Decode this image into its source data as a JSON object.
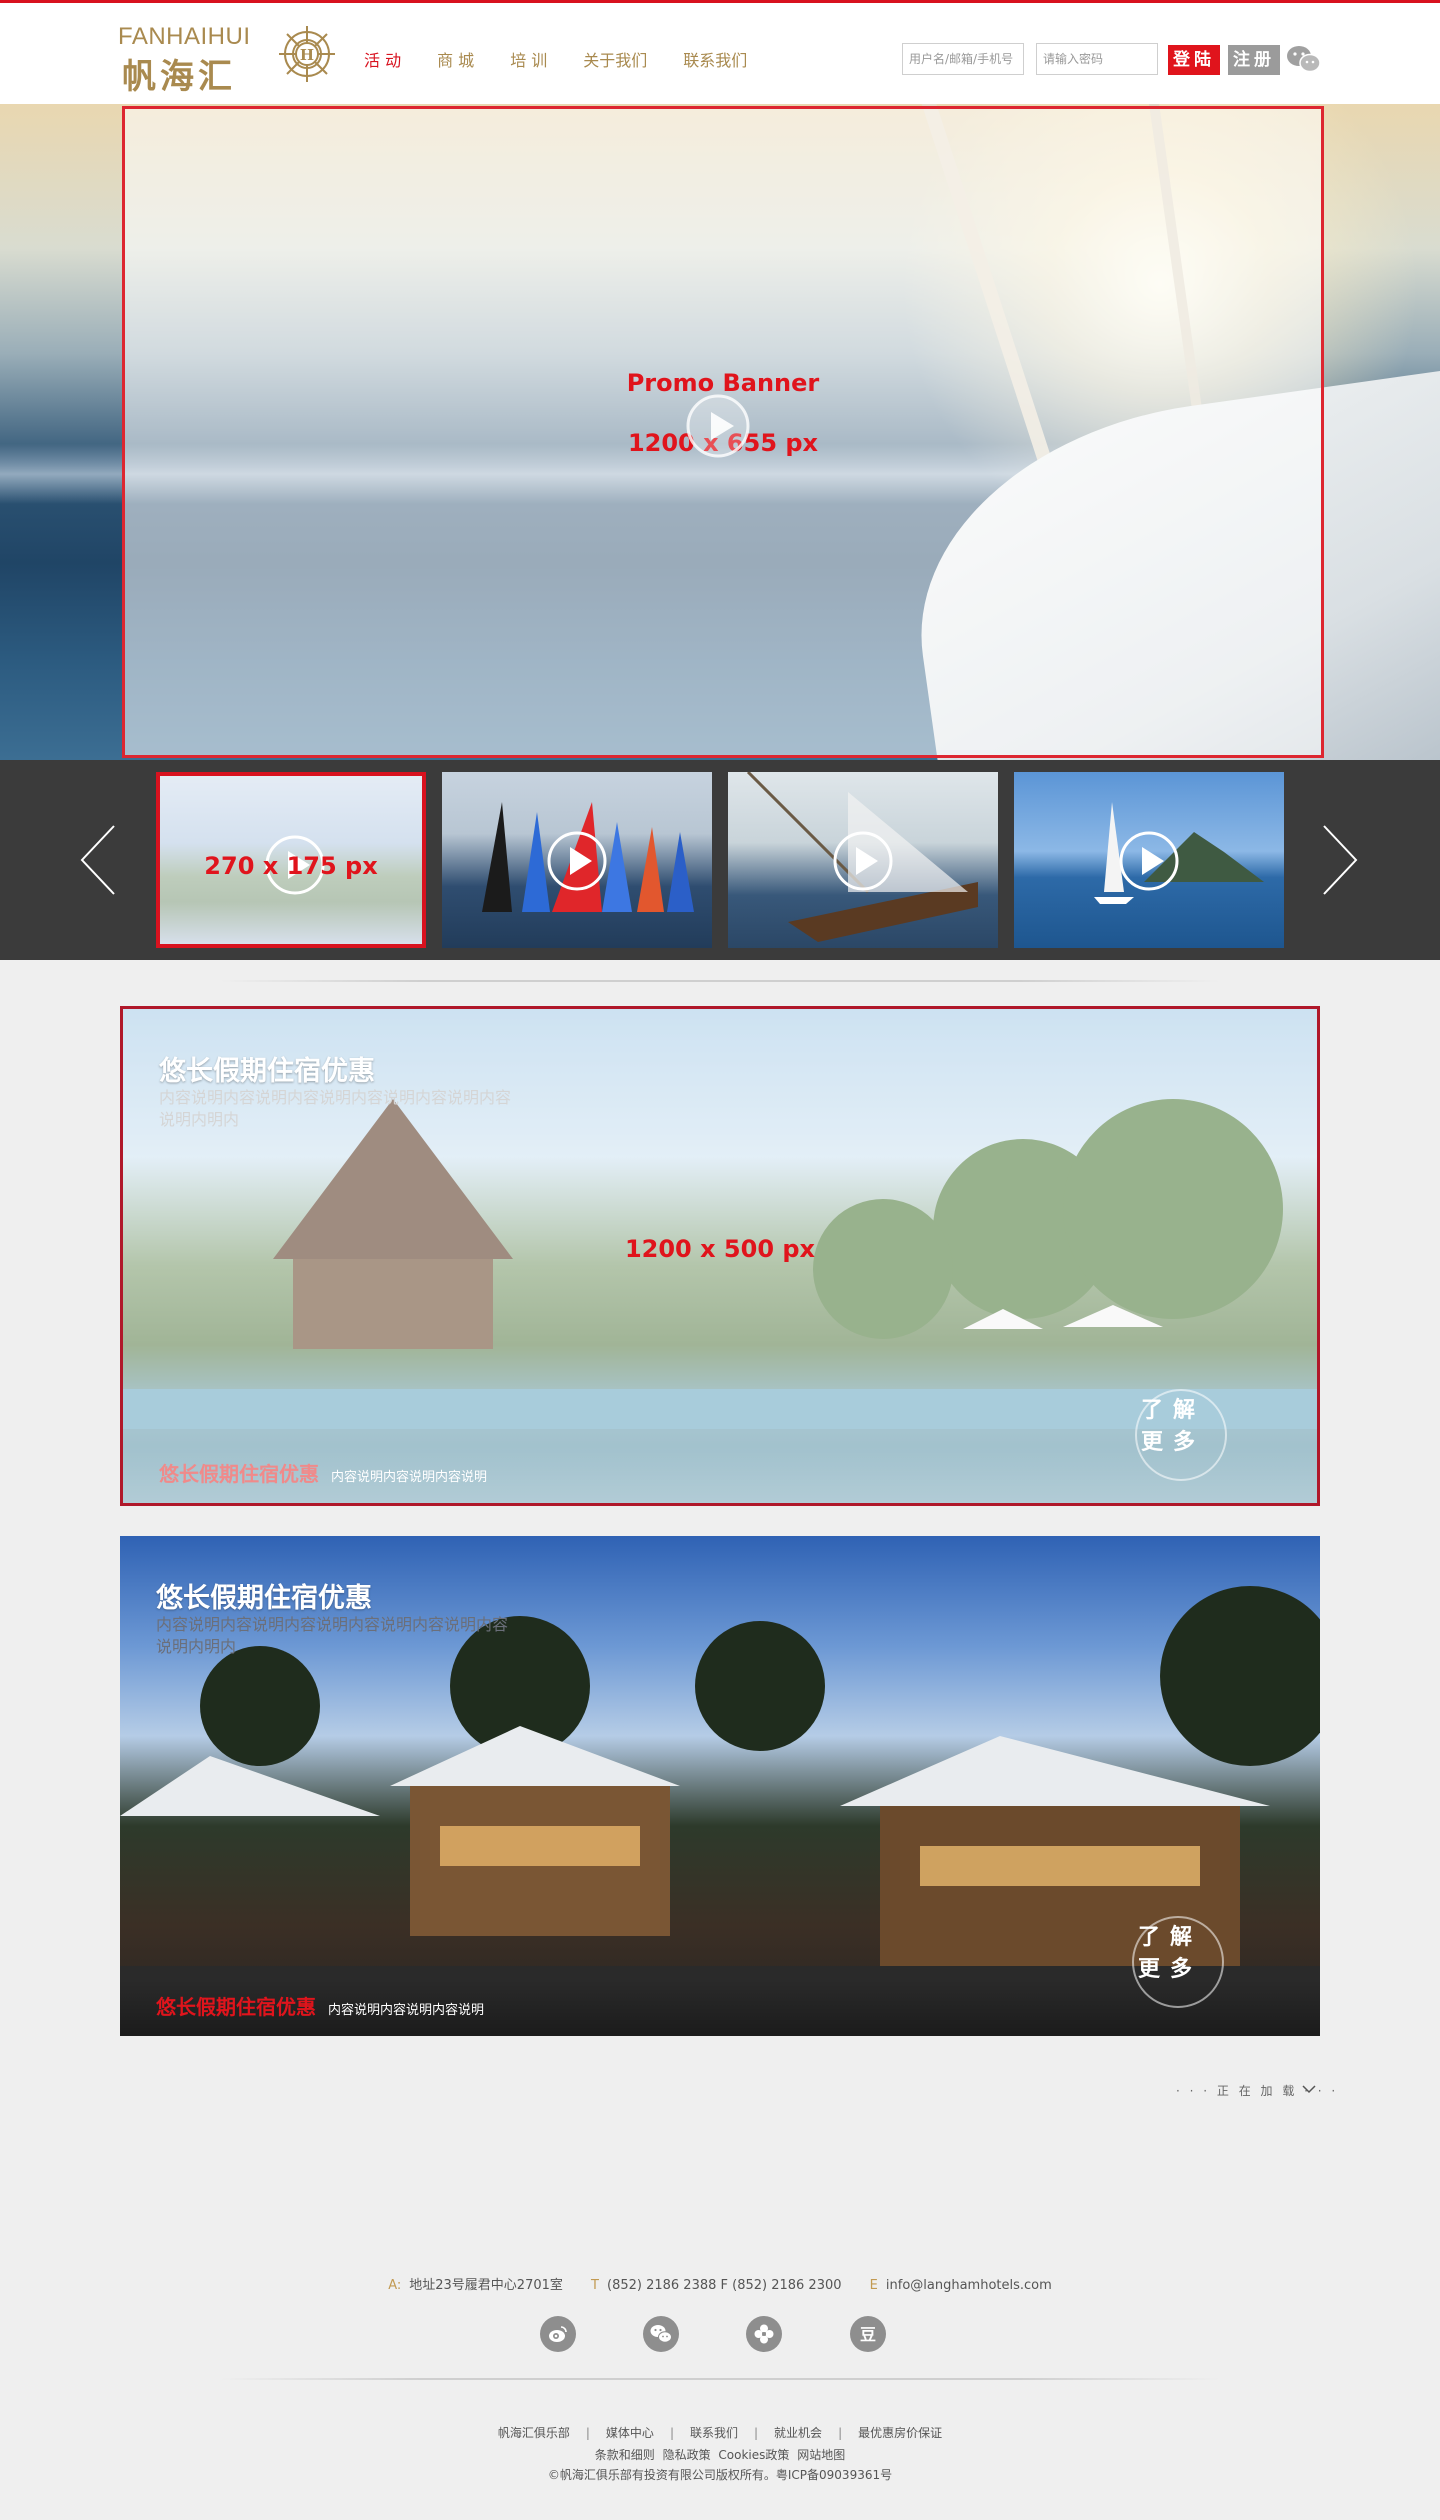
{
  "header": {
    "logo_en": "FANHAIHUI",
    "logo_cn": "帆海汇",
    "nav": [
      {
        "label": "活 动",
        "active": true
      },
      {
        "label": "商 城",
        "active": false
      },
      {
        "label": "培 训",
        "active": false
      },
      {
        "label": "关于我们",
        "active": false
      },
      {
        "label": "联系我们",
        "active": false
      }
    ],
    "username_placeholder": "用户名/邮箱/手机号",
    "password_placeholder": "请输入密码",
    "login_label": "登陆",
    "register_label": "注册",
    "accent_color": "#d8121f",
    "gold_color": "#a98a4f"
  },
  "hero": {
    "title": "Promo Banner",
    "size_label": "1200 x 655 px"
  },
  "thumbnails": {
    "size_label": "270 x 175 px",
    "items": [
      {
        "name": "resort-pavilion",
        "selected": true
      },
      {
        "name": "colorful-sails-regatta",
        "selected": false
      },
      {
        "name": "crew-on-sailboat",
        "selected": false
      },
      {
        "name": "sailboat-island",
        "selected": false
      }
    ]
  },
  "cards": [
    {
      "title": "悠长假期住宿优惠",
      "description": "内容说明内容说明内容说明内容说明内容说明内容说明内明内",
      "footer_title": "悠长假期住宿优惠",
      "footer_text": "内容说明内容说明内容说明",
      "more_label": "了解更多",
      "size_label": "1200 x 500 px"
    },
    {
      "title": "悠长假期住宿优惠",
      "description": "内容说明内容说明内容说明内容说明内容说明内容说明内明内",
      "footer_title": "悠长假期住宿优惠",
      "footer_text": "内容说明内容说明内容说明",
      "more_label": "了解更多"
    }
  ],
  "loading_text": "· · · 正 在 加 载 · · ·",
  "footer": {
    "address_key": "A:",
    "address": "地址23号履君中心2701室",
    "phone_key": "T",
    "phone": "(852) 2186 2388 F (852) 2186 2300",
    "email_key": "E",
    "email": "info@langhamhotels.com",
    "social": [
      "weibo-icon",
      "wechat-icon",
      "clover-icon",
      "douban-icon"
    ],
    "links": [
      "帆海汇俱乐部",
      "媒体中心",
      "联系我们",
      "就业机会",
      "最优惠房价保证"
    ],
    "sub_links": [
      "条款和细则",
      "隐私政策",
      "Cookies政策",
      "网站地图"
    ],
    "copyright": "©帆海汇俱乐部有投资有限公司版权所有。粤ICP备09039361号"
  }
}
